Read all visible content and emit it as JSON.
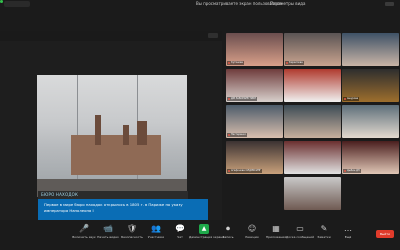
{
  "topbar": {
    "left_badge": "",
    "share_notice": "Вы просматриваете экран пользователя",
    "view_options": "Параметры вида",
    "layout_label": "Вид"
  },
  "share": {
    "caption_title": "БЮРО НАХОДОК",
    "caption_text": "Первое в мире бюро находок открылось в 1805 г. в Париже по указу императора Наполеона I"
  },
  "gallery": {
    "participants": [
      {
        "name": "Кутянова",
        "color": "#6b4e4e",
        "accent": "#d9a08a"
      },
      {
        "name": "Кириллова",
        "color": "#5a5454",
        "accent": "#caa48f"
      },
      {
        "name": "",
        "color": "#3e5266",
        "accent": "#c9b5a7"
      },
      {
        "name": "ДМ ЗАБОРЬЕВ ТИКН",
        "color": "#6f3c3c",
        "accent": "#d8d0cc"
      },
      {
        "name": "",
        "color": "#b03a2e",
        "accent": "#f1f1f1"
      },
      {
        "name": "Ашурова",
        "color": "#2e2e2e",
        "accent": "#9e6f2d"
      },
      {
        "name": "Нестеренко",
        "color": "#4c5c6a",
        "accent": "#d9bfae"
      },
      {
        "name": "",
        "color": "#3c4b55",
        "accent": "#c7b09e"
      },
      {
        "name": "",
        "color": "#5d6f7a",
        "accent": "#e3d9cf"
      },
      {
        "name": "Агафонова ОЛДРИСИНГ",
        "color": "#3b3232",
        "accent": "#c9a17b"
      },
      {
        "name": "",
        "color": "#6b2f2f",
        "accent": "#e2e2e2"
      },
      {
        "name": "Цыбин ДЭ",
        "color": "#4a1e1e",
        "accent": "#e0c7b6"
      },
      {
        "name": "",
        "color": "#c9c9c9",
        "accent": "#6f5a52"
      }
    ]
  },
  "toolbar": {
    "items": [
      {
        "label": "Включить звук",
        "icon": "🎤"
      },
      {
        "label": "Начать видео",
        "icon": "📹"
      },
      {
        "label": "Безопасность",
        "icon": "🛡"
      },
      {
        "label": "Участники",
        "icon": "👥"
      },
      {
        "label": "Чат",
        "icon": "💬"
      },
      {
        "label": "Демонстрация экрана",
        "icon": "▲"
      },
      {
        "label": "Запись",
        "icon": "⏺"
      },
      {
        "label": "Реакции",
        "icon": "☺"
      },
      {
        "label": "Приложения",
        "icon": "▦"
      },
      {
        "label": "Доска сообщений",
        "icon": "▭"
      },
      {
        "label": "Заметки",
        "icon": "✎"
      },
      {
        "label": "Ещё",
        "icon": "…"
      }
    ],
    "end_label": "Выйти"
  },
  "colors": {
    "background": "#1b1b1b",
    "caption_blue": "#0a6db5",
    "share_green": "#1ea94a",
    "end_red": "#e03b2b"
  }
}
